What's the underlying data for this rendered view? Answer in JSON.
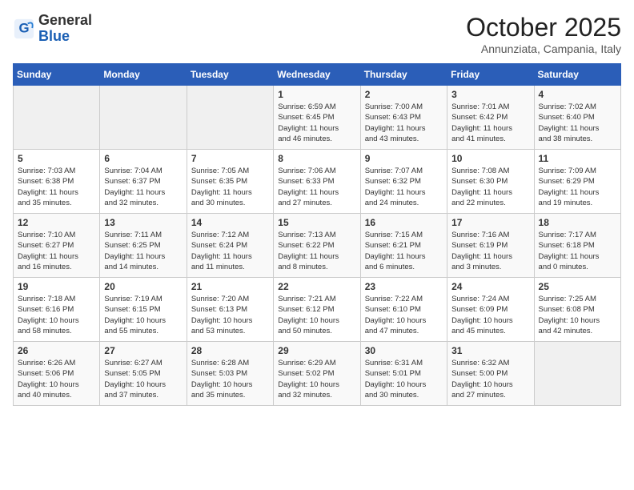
{
  "header": {
    "logo_line1": "General",
    "logo_line2": "Blue",
    "month": "October 2025",
    "location": "Annunziata, Campania, Italy"
  },
  "days_of_week": [
    "Sunday",
    "Monday",
    "Tuesday",
    "Wednesday",
    "Thursday",
    "Friday",
    "Saturday"
  ],
  "weeks": [
    [
      {
        "day": "",
        "info": ""
      },
      {
        "day": "",
        "info": ""
      },
      {
        "day": "",
        "info": ""
      },
      {
        "day": "1",
        "info": "Sunrise: 6:59 AM\nSunset: 6:45 PM\nDaylight: 11 hours\nand 46 minutes."
      },
      {
        "day": "2",
        "info": "Sunrise: 7:00 AM\nSunset: 6:43 PM\nDaylight: 11 hours\nand 43 minutes."
      },
      {
        "day": "3",
        "info": "Sunrise: 7:01 AM\nSunset: 6:42 PM\nDaylight: 11 hours\nand 41 minutes."
      },
      {
        "day": "4",
        "info": "Sunrise: 7:02 AM\nSunset: 6:40 PM\nDaylight: 11 hours\nand 38 minutes."
      }
    ],
    [
      {
        "day": "5",
        "info": "Sunrise: 7:03 AM\nSunset: 6:38 PM\nDaylight: 11 hours\nand 35 minutes."
      },
      {
        "day": "6",
        "info": "Sunrise: 7:04 AM\nSunset: 6:37 PM\nDaylight: 11 hours\nand 32 minutes."
      },
      {
        "day": "7",
        "info": "Sunrise: 7:05 AM\nSunset: 6:35 PM\nDaylight: 11 hours\nand 30 minutes."
      },
      {
        "day": "8",
        "info": "Sunrise: 7:06 AM\nSunset: 6:33 PM\nDaylight: 11 hours\nand 27 minutes."
      },
      {
        "day": "9",
        "info": "Sunrise: 7:07 AM\nSunset: 6:32 PM\nDaylight: 11 hours\nand 24 minutes."
      },
      {
        "day": "10",
        "info": "Sunrise: 7:08 AM\nSunset: 6:30 PM\nDaylight: 11 hours\nand 22 minutes."
      },
      {
        "day": "11",
        "info": "Sunrise: 7:09 AM\nSunset: 6:29 PM\nDaylight: 11 hours\nand 19 minutes."
      }
    ],
    [
      {
        "day": "12",
        "info": "Sunrise: 7:10 AM\nSunset: 6:27 PM\nDaylight: 11 hours\nand 16 minutes."
      },
      {
        "day": "13",
        "info": "Sunrise: 7:11 AM\nSunset: 6:25 PM\nDaylight: 11 hours\nand 14 minutes."
      },
      {
        "day": "14",
        "info": "Sunrise: 7:12 AM\nSunset: 6:24 PM\nDaylight: 11 hours\nand 11 minutes."
      },
      {
        "day": "15",
        "info": "Sunrise: 7:13 AM\nSunset: 6:22 PM\nDaylight: 11 hours\nand 8 minutes."
      },
      {
        "day": "16",
        "info": "Sunrise: 7:15 AM\nSunset: 6:21 PM\nDaylight: 11 hours\nand 6 minutes."
      },
      {
        "day": "17",
        "info": "Sunrise: 7:16 AM\nSunset: 6:19 PM\nDaylight: 11 hours\nand 3 minutes."
      },
      {
        "day": "18",
        "info": "Sunrise: 7:17 AM\nSunset: 6:18 PM\nDaylight: 11 hours\nand 0 minutes."
      }
    ],
    [
      {
        "day": "19",
        "info": "Sunrise: 7:18 AM\nSunset: 6:16 PM\nDaylight: 10 hours\nand 58 minutes."
      },
      {
        "day": "20",
        "info": "Sunrise: 7:19 AM\nSunset: 6:15 PM\nDaylight: 10 hours\nand 55 minutes."
      },
      {
        "day": "21",
        "info": "Sunrise: 7:20 AM\nSunset: 6:13 PM\nDaylight: 10 hours\nand 53 minutes."
      },
      {
        "day": "22",
        "info": "Sunrise: 7:21 AM\nSunset: 6:12 PM\nDaylight: 10 hours\nand 50 minutes."
      },
      {
        "day": "23",
        "info": "Sunrise: 7:22 AM\nSunset: 6:10 PM\nDaylight: 10 hours\nand 47 minutes."
      },
      {
        "day": "24",
        "info": "Sunrise: 7:24 AM\nSunset: 6:09 PM\nDaylight: 10 hours\nand 45 minutes."
      },
      {
        "day": "25",
        "info": "Sunrise: 7:25 AM\nSunset: 6:08 PM\nDaylight: 10 hours\nand 42 minutes."
      }
    ],
    [
      {
        "day": "26",
        "info": "Sunrise: 6:26 AM\nSunset: 5:06 PM\nDaylight: 10 hours\nand 40 minutes."
      },
      {
        "day": "27",
        "info": "Sunrise: 6:27 AM\nSunset: 5:05 PM\nDaylight: 10 hours\nand 37 minutes."
      },
      {
        "day": "28",
        "info": "Sunrise: 6:28 AM\nSunset: 5:03 PM\nDaylight: 10 hours\nand 35 minutes."
      },
      {
        "day": "29",
        "info": "Sunrise: 6:29 AM\nSunset: 5:02 PM\nDaylight: 10 hours\nand 32 minutes."
      },
      {
        "day": "30",
        "info": "Sunrise: 6:31 AM\nSunset: 5:01 PM\nDaylight: 10 hours\nand 30 minutes."
      },
      {
        "day": "31",
        "info": "Sunrise: 6:32 AM\nSunset: 5:00 PM\nDaylight: 10 hours\nand 27 minutes."
      },
      {
        "day": "",
        "info": ""
      }
    ]
  ]
}
